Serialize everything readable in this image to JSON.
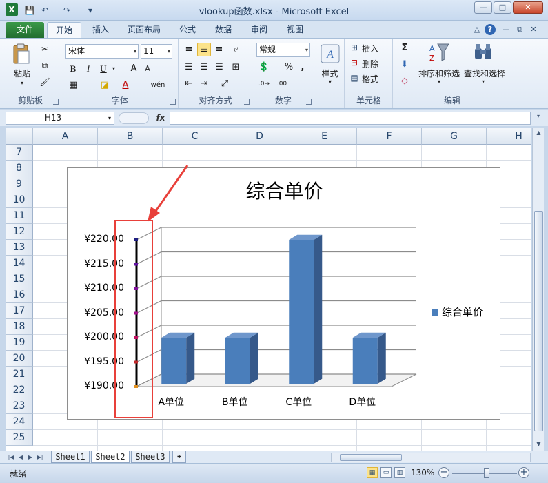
{
  "window": {
    "app_icon": "X",
    "title": "vlookup函数.xlsx - Microsoft Excel",
    "minimize": "—",
    "maximize": "□",
    "close": "✕"
  },
  "quick_access": {
    "save_icon": "💾",
    "undo_icon": "↶",
    "redo_icon": "↷",
    "customize_icon": "▾"
  },
  "ribbon_tabs": [
    "文件",
    "开始",
    "插入",
    "页面布局",
    "公式",
    "数据",
    "审阅",
    "视图"
  ],
  "ribbon_right_icons": [
    "△",
    "?",
    "—",
    "⧉",
    "✕"
  ],
  "ribbon": {
    "clipboard": {
      "paste": "粘贴",
      "label": "剪贴板"
    },
    "font": {
      "font_name": "宋体",
      "font_size": "11",
      "bold": "B",
      "italic": "I",
      "underline": "U",
      "grow": "A",
      "shrink": "A",
      "phonetic": "wén",
      "label": "字体"
    },
    "alignment": {
      "label": "对齐方式"
    },
    "number": {
      "format": "常规",
      "percent": "%",
      "comma": ",",
      "label": "数字"
    },
    "styles": {
      "styles": "样式"
    },
    "cells": {
      "insert": "插入",
      "delete": "删除",
      "format": "格式",
      "label": "单元格"
    },
    "editing": {
      "sigma": "Σ",
      "sort_filter": "排序和筛选",
      "find_select": "查找和选择",
      "label": "编辑"
    }
  },
  "formula_bar": {
    "name_box": "H13",
    "fx": "fx",
    "value": ""
  },
  "columns": [
    "A",
    "B",
    "C",
    "D",
    "E",
    "F",
    "G",
    "H"
  ],
  "rows": [
    "7",
    "8",
    "9",
    "10",
    "11",
    "12",
    "13",
    "14",
    "15",
    "16",
    "17",
    "18",
    "19",
    "20",
    "21",
    "22",
    "23",
    "24",
    "25"
  ],
  "chart_data": {
    "type": "bar",
    "style": "3d-column",
    "title": "综合单价",
    "categories": [
      "A单位",
      "B单位",
      "C单位",
      "D单位"
    ],
    "series": [
      {
        "name": "综合单价",
        "values": [
          200,
          200,
          220,
          200
        ],
        "color": "#4a7ebb"
      }
    ],
    "y_tick_labels": [
      "¥190.00",
      "¥195.00",
      "¥200.00",
      "¥205.00",
      "¥210.00",
      "¥215.00",
      "¥220.00"
    ],
    "ylim": [
      190,
      220
    ],
    "ytick_step": 5,
    "grid": true,
    "legend": "right",
    "xlabel": "",
    "ylabel": ""
  },
  "annotation": {
    "color": "#e8403a"
  },
  "sheets": [
    "Sheet1",
    "Sheet2",
    "Sheet3"
  ],
  "active_sheet": "Sheet2",
  "status": {
    "ready": "就绪",
    "zoom": "130%"
  },
  "colors": {
    "accent_green": "#217346",
    "bar_blue": "#4a7ebb"
  }
}
